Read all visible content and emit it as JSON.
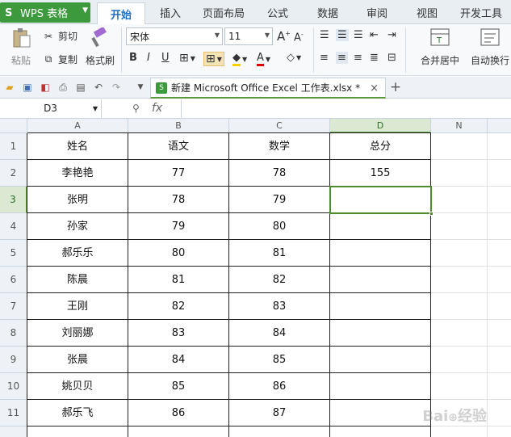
{
  "app": {
    "name": "WPS 表格"
  },
  "tabs": [
    "开始",
    "插入",
    "页面布局",
    "公式",
    "数据",
    "审阅",
    "视图",
    "开发工具"
  ],
  "active_tab": "开始",
  "ribbon": {
    "paste_label": "粘贴",
    "cut_label": "剪切",
    "copy_label": "复制",
    "format_painter_label": "格式刷",
    "font_name": "宋体",
    "font_size": "11",
    "merge_center_label": "合并居中",
    "wrap_text_label": "自动换行"
  },
  "document_tab": {
    "title": "新建 Microsoft Office Excel 工作表.xlsx *"
  },
  "formula_bar": {
    "name_box": "D3",
    "fx_label": "fx",
    "content": ""
  },
  "sheet": {
    "columns": [
      "A",
      "B",
      "C",
      "D",
      "N"
    ],
    "headers": [
      "姓名",
      "语文",
      "数学",
      "总分"
    ],
    "rows": [
      {
        "row": "1",
        "cells": [
          "姓名",
          "语文",
          "数学",
          "总分"
        ]
      },
      {
        "row": "2",
        "cells": [
          "李艳艳",
          "77",
          "78",
          "155"
        ]
      },
      {
        "row": "3",
        "cells": [
          "张明",
          "78",
          "79",
          ""
        ]
      },
      {
        "row": "4",
        "cells": [
          "孙家",
          "79",
          "80",
          ""
        ]
      },
      {
        "row": "5",
        "cells": [
          "郝乐乐",
          "80",
          "81",
          ""
        ]
      },
      {
        "row": "6",
        "cells": [
          "陈晨",
          "81",
          "82",
          ""
        ]
      },
      {
        "row": "7",
        "cells": [
          "王刚",
          "82",
          "83",
          ""
        ]
      },
      {
        "row": "8",
        "cells": [
          "刘丽娜",
          "83",
          "84",
          ""
        ]
      },
      {
        "row": "9",
        "cells": [
          "张晨",
          "84",
          "85",
          ""
        ]
      },
      {
        "row": "10",
        "cells": [
          "姚贝贝",
          "85",
          "86",
          ""
        ]
      },
      {
        "row": "11",
        "cells": [
          "郝乐飞",
          "86",
          "87",
          ""
        ]
      }
    ],
    "selected_cell": "D3"
  },
  "colors": {
    "accent": "#3c9a3c",
    "selection": "#4e8c2e",
    "tab_active_text": "#1e6dc2"
  }
}
